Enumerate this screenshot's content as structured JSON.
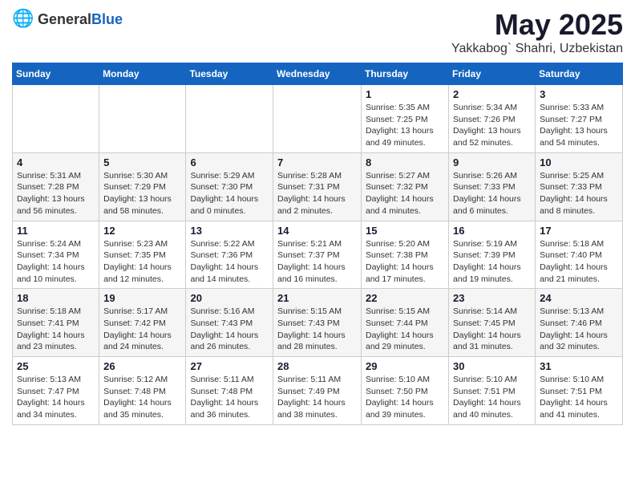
{
  "header": {
    "logo_general": "General",
    "logo_blue": "Blue",
    "month_title": "May 2025",
    "location": "Yakkabog` Shahri, Uzbekistan"
  },
  "weekdays": [
    "Sunday",
    "Monday",
    "Tuesday",
    "Wednesday",
    "Thursday",
    "Friday",
    "Saturday"
  ],
  "weeks": [
    [
      {
        "day": "",
        "info": ""
      },
      {
        "day": "",
        "info": ""
      },
      {
        "day": "",
        "info": ""
      },
      {
        "day": "",
        "info": ""
      },
      {
        "day": "1",
        "info": "Sunrise: 5:35 AM\nSunset: 7:25 PM\nDaylight: 13 hours\nand 49 minutes."
      },
      {
        "day": "2",
        "info": "Sunrise: 5:34 AM\nSunset: 7:26 PM\nDaylight: 13 hours\nand 52 minutes."
      },
      {
        "day": "3",
        "info": "Sunrise: 5:33 AM\nSunset: 7:27 PM\nDaylight: 13 hours\nand 54 minutes."
      }
    ],
    [
      {
        "day": "4",
        "info": "Sunrise: 5:31 AM\nSunset: 7:28 PM\nDaylight: 13 hours\nand 56 minutes."
      },
      {
        "day": "5",
        "info": "Sunrise: 5:30 AM\nSunset: 7:29 PM\nDaylight: 13 hours\nand 58 minutes."
      },
      {
        "day": "6",
        "info": "Sunrise: 5:29 AM\nSunset: 7:30 PM\nDaylight: 14 hours\nand 0 minutes."
      },
      {
        "day": "7",
        "info": "Sunrise: 5:28 AM\nSunset: 7:31 PM\nDaylight: 14 hours\nand 2 minutes."
      },
      {
        "day": "8",
        "info": "Sunrise: 5:27 AM\nSunset: 7:32 PM\nDaylight: 14 hours\nand 4 minutes."
      },
      {
        "day": "9",
        "info": "Sunrise: 5:26 AM\nSunset: 7:33 PM\nDaylight: 14 hours\nand 6 minutes."
      },
      {
        "day": "10",
        "info": "Sunrise: 5:25 AM\nSunset: 7:33 PM\nDaylight: 14 hours\nand 8 minutes."
      }
    ],
    [
      {
        "day": "11",
        "info": "Sunrise: 5:24 AM\nSunset: 7:34 PM\nDaylight: 14 hours\nand 10 minutes."
      },
      {
        "day": "12",
        "info": "Sunrise: 5:23 AM\nSunset: 7:35 PM\nDaylight: 14 hours\nand 12 minutes."
      },
      {
        "day": "13",
        "info": "Sunrise: 5:22 AM\nSunset: 7:36 PM\nDaylight: 14 hours\nand 14 minutes."
      },
      {
        "day": "14",
        "info": "Sunrise: 5:21 AM\nSunset: 7:37 PM\nDaylight: 14 hours\nand 16 minutes."
      },
      {
        "day": "15",
        "info": "Sunrise: 5:20 AM\nSunset: 7:38 PM\nDaylight: 14 hours\nand 17 minutes."
      },
      {
        "day": "16",
        "info": "Sunrise: 5:19 AM\nSunset: 7:39 PM\nDaylight: 14 hours\nand 19 minutes."
      },
      {
        "day": "17",
        "info": "Sunrise: 5:18 AM\nSunset: 7:40 PM\nDaylight: 14 hours\nand 21 minutes."
      }
    ],
    [
      {
        "day": "18",
        "info": "Sunrise: 5:18 AM\nSunset: 7:41 PM\nDaylight: 14 hours\nand 23 minutes."
      },
      {
        "day": "19",
        "info": "Sunrise: 5:17 AM\nSunset: 7:42 PM\nDaylight: 14 hours\nand 24 minutes."
      },
      {
        "day": "20",
        "info": "Sunrise: 5:16 AM\nSunset: 7:43 PM\nDaylight: 14 hours\nand 26 minutes."
      },
      {
        "day": "21",
        "info": "Sunrise: 5:15 AM\nSunset: 7:43 PM\nDaylight: 14 hours\nand 28 minutes."
      },
      {
        "day": "22",
        "info": "Sunrise: 5:15 AM\nSunset: 7:44 PM\nDaylight: 14 hours\nand 29 minutes."
      },
      {
        "day": "23",
        "info": "Sunrise: 5:14 AM\nSunset: 7:45 PM\nDaylight: 14 hours\nand 31 minutes."
      },
      {
        "day": "24",
        "info": "Sunrise: 5:13 AM\nSunset: 7:46 PM\nDaylight: 14 hours\nand 32 minutes."
      }
    ],
    [
      {
        "day": "25",
        "info": "Sunrise: 5:13 AM\nSunset: 7:47 PM\nDaylight: 14 hours\nand 34 minutes."
      },
      {
        "day": "26",
        "info": "Sunrise: 5:12 AM\nSunset: 7:48 PM\nDaylight: 14 hours\nand 35 minutes."
      },
      {
        "day": "27",
        "info": "Sunrise: 5:11 AM\nSunset: 7:48 PM\nDaylight: 14 hours\nand 36 minutes."
      },
      {
        "day": "28",
        "info": "Sunrise: 5:11 AM\nSunset: 7:49 PM\nDaylight: 14 hours\nand 38 minutes."
      },
      {
        "day": "29",
        "info": "Sunrise: 5:10 AM\nSunset: 7:50 PM\nDaylight: 14 hours\nand 39 minutes."
      },
      {
        "day": "30",
        "info": "Sunrise: 5:10 AM\nSunset: 7:51 PM\nDaylight: 14 hours\nand 40 minutes."
      },
      {
        "day": "31",
        "info": "Sunrise: 5:10 AM\nSunset: 7:51 PM\nDaylight: 14 hours\nand 41 minutes."
      }
    ]
  ]
}
